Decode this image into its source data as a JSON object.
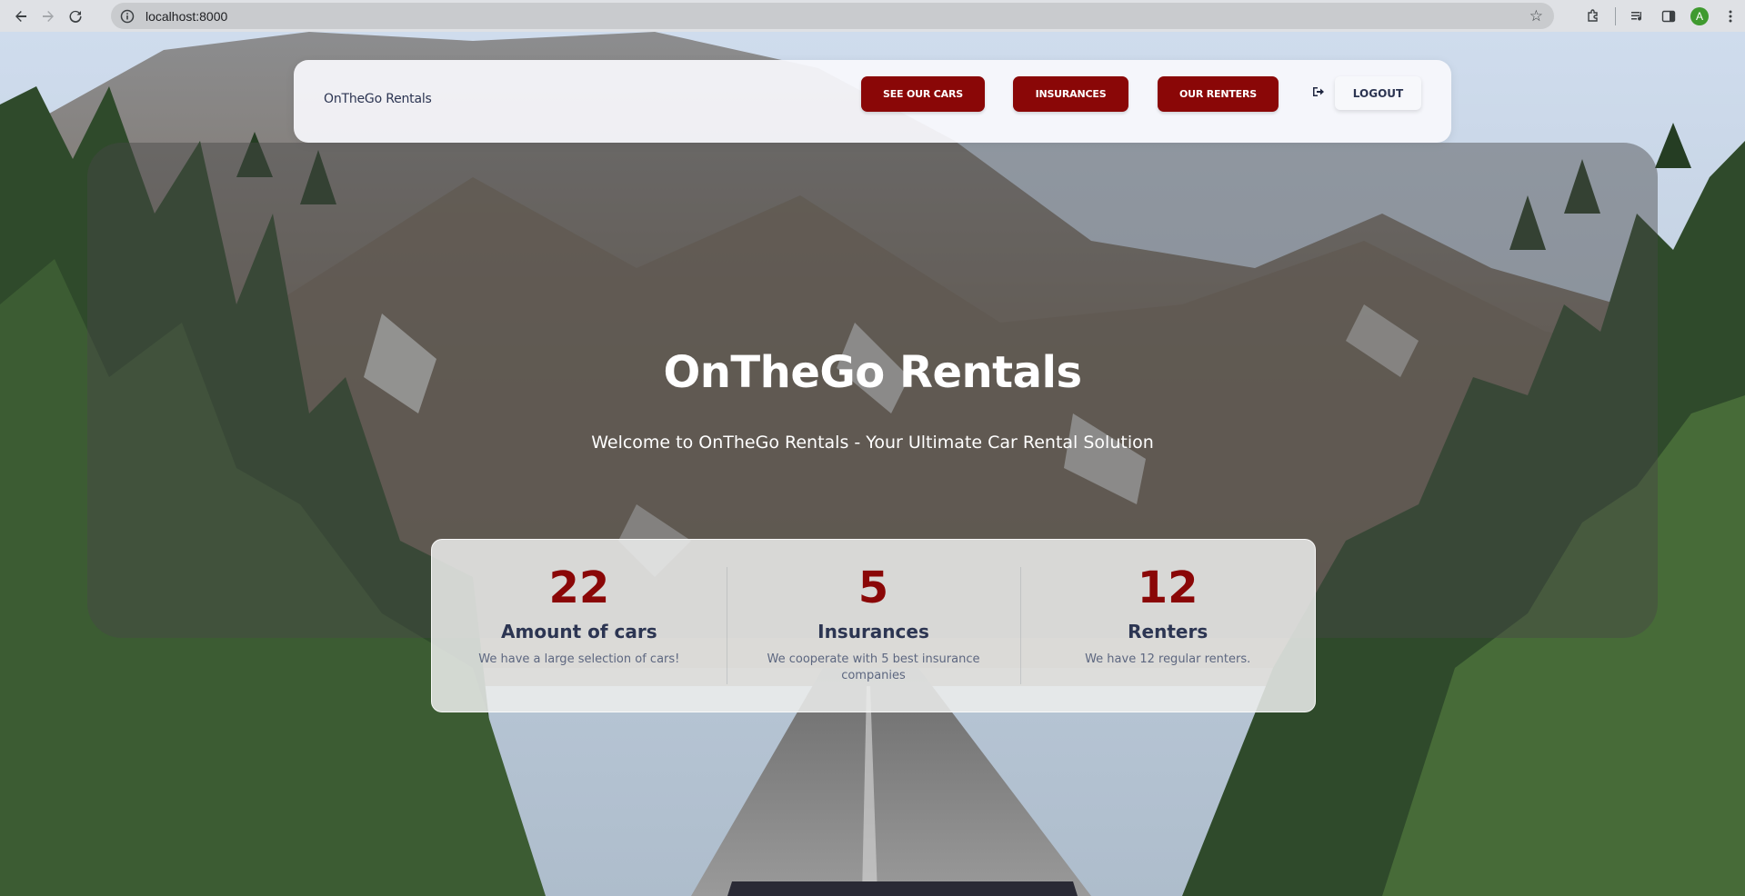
{
  "browser": {
    "url": "localhost:8000",
    "avatar_initial": "A",
    "icons": [
      "back-icon",
      "forward-icon",
      "reload-icon",
      "info-icon",
      "star-icon",
      "extensions-icon",
      "media-icon",
      "sidepanel-icon",
      "menu-icon"
    ]
  },
  "navbar": {
    "brand": "OnTheGo Rentals",
    "links": [
      {
        "label": "SEE OUR CARS"
      },
      {
        "label": "INSURANCES"
      },
      {
        "label": "OUR RENTERS"
      }
    ],
    "logout_label": "LOGOUT"
  },
  "hero": {
    "title": "OnTheGo Rentals",
    "subtitle": "Welcome to OnTheGo Rentals - Your Ultimate Car Rental Solution"
  },
  "stats": [
    {
      "value": "22",
      "label": "Amount of cars",
      "description": "We have a large selection of cars!"
    },
    {
      "value": "5",
      "label": "Insurances",
      "description": "We cooperate with 5 best insurance companies"
    },
    {
      "value": "12",
      "label": "Renters",
      "description": "We have 12 regular renters."
    }
  ],
  "colors": {
    "accent": "#8a0707",
    "navy_text": "#2c3552"
  }
}
